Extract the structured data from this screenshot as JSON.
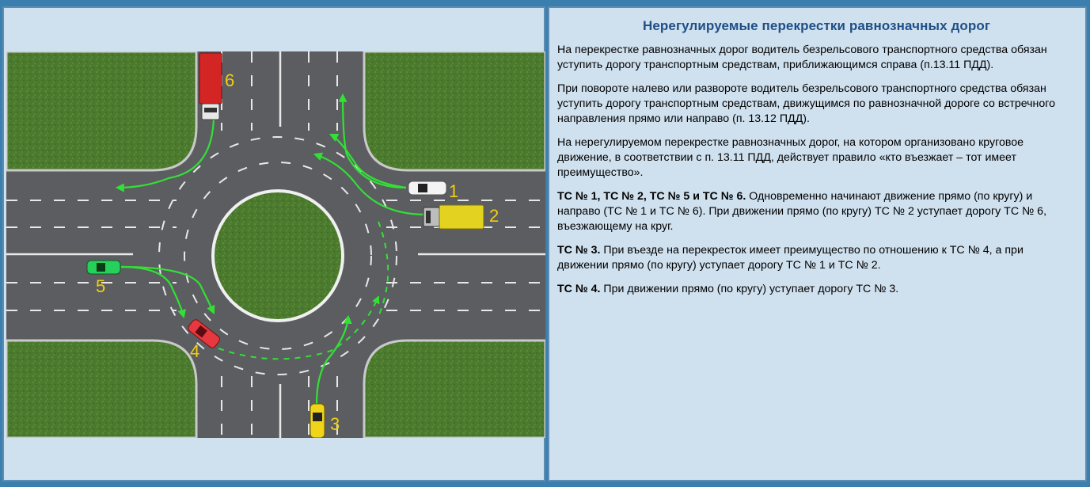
{
  "title": "Нерегулируемые перекрестки равнозначных дорог",
  "paragraphs": [
    {
      "bold": "",
      "text": "На перекрестке равнозначных дорог водитель безрельсового транспортного средства обязан уступить дорогу транспортным средствам, приближающимся справа (п.13.11 ПДД)."
    },
    {
      "bold": "",
      "text": "При повороте налево или развороте водитель безрельсового транспортного средства обязан уступить дорогу транспортным средствам, движущимся по равнозначной дороге со встречного направления прямо или направо (п. 13.12 ПДД)."
    },
    {
      "bold": "",
      "text": "На нерегулируемом перекрестке равнозначных дорог, на котором организовано круговое движение, в соответствии с п. 13.11 ПДД, действует правило «кто въезжает – тот имеет преимущество»."
    },
    {
      "bold": "ТС № 1, ТС № 2, ТС № 5 и ТС № 6.",
      "text": " Одновременно начинают движение прямо (по кругу) и направо (ТС № 1 и ТС № 6). При движении прямо (по кругу) ТС № 2 уступает дорогу ТС № 6, въезжающему на круг."
    },
    {
      "bold": "ТС № 3.",
      "text": " При въезде на перекресток имеет преимущество по отношению к ТС № 4, а при движении прямо (по кругу) уступает дорогу ТС № 1 и ТС № 2."
    },
    {
      "bold": "ТС № 4.",
      "text": " При движении прямо (по кругу) уступает дорогу ТС № 3."
    }
  ],
  "vehicles": {
    "v1": "1",
    "v2": "2",
    "v3": "3",
    "v4": "4",
    "v5": "5",
    "v6": "6"
  },
  "colors": {
    "grass": "#4b7a2e",
    "asphalt": "#5b5d60",
    "arrow": "#33e036",
    "label": "#f2cf12",
    "title": "#1f4f86"
  }
}
